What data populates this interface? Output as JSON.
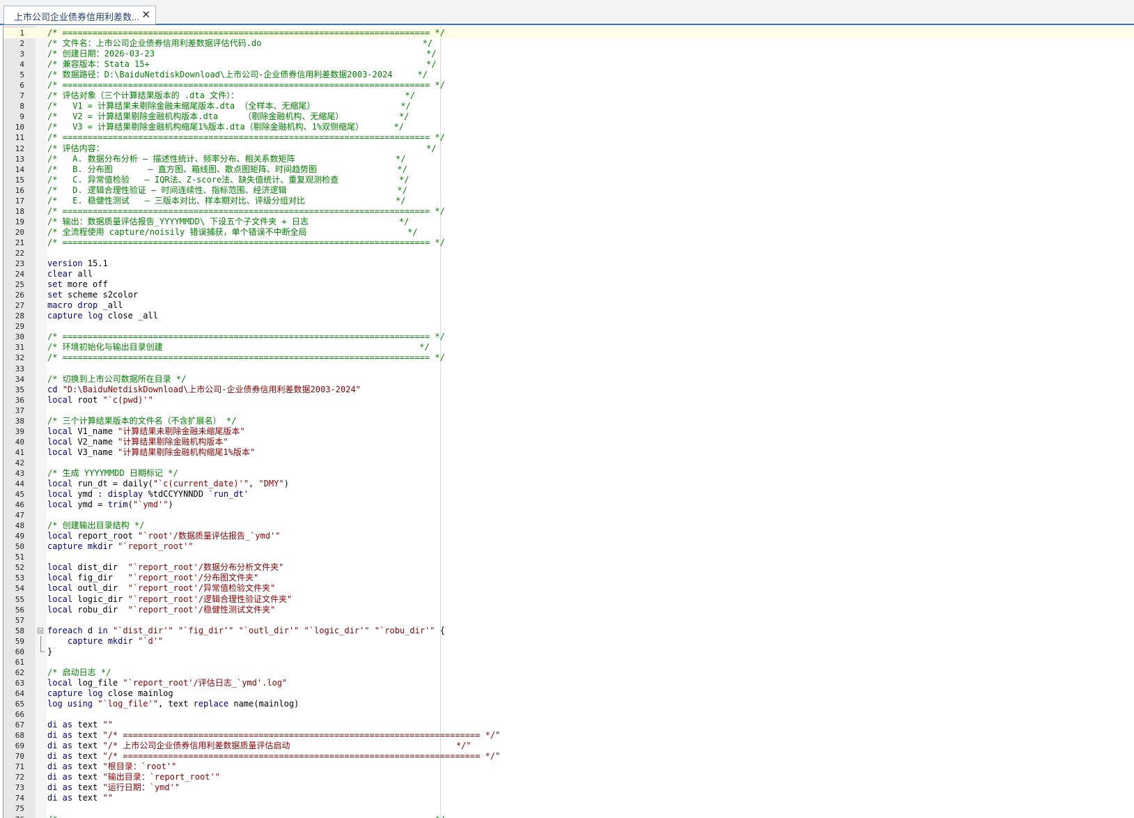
{
  "tab": {
    "title": "上市公司企业债券信用利差数...",
    "close": "✕"
  },
  "colors": {
    "comment": "#008000",
    "keyword": "#00008b",
    "string": "#8b0000",
    "plain": "#000000",
    "accent": "#3c73b4"
  },
  "current_line": 1,
  "fold": {
    "start": 58,
    "end": 60
  },
  "lines": [
    {
      "n": "1",
      "t": [
        {
          "c": "comment",
          "s": "/* ========================================================================= */"
        }
      ]
    },
    {
      "n": "2",
      "t": [
        {
          "c": "comment",
          "s": "/* 文件名：上市公司企业债券信用利差数据评估代码.do                                */"
        }
      ]
    },
    {
      "n": "3",
      "t": [
        {
          "c": "comment",
          "s": "/* 创建日期：2026-03-23                                                      */"
        }
      ]
    },
    {
      "n": "4",
      "t": [
        {
          "c": "comment",
          "s": "/* 兼容版本：Stata 15+                                                       */"
        }
      ]
    },
    {
      "n": "5",
      "t": [
        {
          "c": "comment",
          "s": "/* 数据路径：D:\\BaiduNetdiskDownload\\上市公司-企业债券信用利差数据2003-2024     */"
        }
      ]
    },
    {
      "n": "6",
      "t": [
        {
          "c": "comment",
          "s": "/* ========================================================================= */"
        }
      ]
    },
    {
      "n": "7",
      "t": [
        {
          "c": "comment",
          "s": "/* 评估对象（三个计算结果版本的 .dta 文件）：                                 */"
        }
      ]
    },
    {
      "n": "8",
      "t": [
        {
          "c": "comment",
          "s": "/*   V1 = 计算结果未剔除金融未缩尾版本.dta （全样本、无缩尾）                 */"
        }
      ]
    },
    {
      "n": "9",
      "t": [
        {
          "c": "comment",
          "s": "/*   V2 = 计算结果剔除金融机构版本.dta     （剔除金融机构、无缩尾）           */"
        }
      ]
    },
    {
      "n": "10",
      "t": [
        {
          "c": "comment",
          "s": "/*   V3 = 计算结果剔除金融机构缩尾1%版本.dta（剔除金融机构、1%双侧缩尾）      */"
        }
      ]
    },
    {
      "n": "11",
      "t": [
        {
          "c": "comment",
          "s": "/* ========================================================================= */"
        }
      ]
    },
    {
      "n": "12",
      "t": [
        {
          "c": "comment",
          "s": "/* 评估内容：                                                                */"
        }
      ]
    },
    {
      "n": "13",
      "t": [
        {
          "c": "comment",
          "s": "/*   A. 数据分布分析 — 描述性统计、频率分布、相关系数矩阵                    */"
        }
      ]
    },
    {
      "n": "14",
      "t": [
        {
          "c": "comment",
          "s": "/*   B. 分布图       — 直方图、箱线图、散点图矩阵、时间趋势图                */"
        }
      ]
    },
    {
      "n": "15",
      "t": [
        {
          "c": "comment",
          "s": "/*   C. 异常值检验   — IQR法、Z-score法、缺失值统计、重复观测检查            */"
        }
      ]
    },
    {
      "n": "16",
      "t": [
        {
          "c": "comment",
          "s": "/*   D. 逻辑合理性验证 — 时间连续性、指标范围、经济逻辑                      */"
        }
      ]
    },
    {
      "n": "17",
      "t": [
        {
          "c": "comment",
          "s": "/*   E. 稳健性测试   — 三版本对比、样本期对比、评级分组对比                  */"
        }
      ]
    },
    {
      "n": "18",
      "t": [
        {
          "c": "comment",
          "s": "/* ========================================================================= */"
        }
      ]
    },
    {
      "n": "19",
      "t": [
        {
          "c": "comment",
          "s": "/* 输出：数据质量评估报告_YYYYMMDD\\ 下设五个子文件夹 + 日志                  */"
        }
      ]
    },
    {
      "n": "20",
      "t": [
        {
          "c": "comment",
          "s": "/* 全流程使用 capture/noisily 错误捕获，单个错误不中断全局                    */"
        }
      ]
    },
    {
      "n": "21",
      "t": [
        {
          "c": "comment",
          "s": "/* ========================================================================= */"
        }
      ]
    },
    {
      "n": "22",
      "t": []
    },
    {
      "n": "23",
      "t": [
        {
          "c": "keyword",
          "s": "version"
        },
        {
          "c": "plain",
          "s": " 15.1"
        }
      ]
    },
    {
      "n": "24",
      "t": [
        {
          "c": "keyword",
          "s": "clear"
        },
        {
          "c": "plain",
          "s": " all"
        }
      ]
    },
    {
      "n": "25",
      "t": [
        {
          "c": "keyword",
          "s": "set"
        },
        {
          "c": "plain",
          "s": " more off"
        }
      ]
    },
    {
      "n": "26",
      "t": [
        {
          "c": "keyword",
          "s": "set"
        },
        {
          "c": "plain",
          "s": " scheme s2color"
        }
      ]
    },
    {
      "n": "27",
      "t": [
        {
          "c": "keyword",
          "s": "macro drop"
        },
        {
          "c": "plain",
          "s": " _all"
        }
      ]
    },
    {
      "n": "28",
      "t": [
        {
          "c": "keyword",
          "s": "capture log"
        },
        {
          "c": "plain",
          "s": " close _all"
        }
      ]
    },
    {
      "n": "29",
      "t": []
    },
    {
      "n": "30",
      "t": [
        {
          "c": "comment",
          "s": "/* ========================================================================= */"
        }
      ]
    },
    {
      "n": "31",
      "t": [
        {
          "c": "comment",
          "s": "/* 环境初始化与输出目录创建                                                   */"
        }
      ]
    },
    {
      "n": "32",
      "t": [
        {
          "c": "comment",
          "s": "/* ========================================================================= */"
        }
      ]
    },
    {
      "n": "33",
      "t": []
    },
    {
      "n": "34",
      "t": [
        {
          "c": "comment",
          "s": "/* 切换到上市公司数据所在目录 */"
        }
      ]
    },
    {
      "n": "35",
      "t": [
        {
          "c": "keyword",
          "s": "cd"
        },
        {
          "c": "plain",
          "s": " "
        },
        {
          "c": "string",
          "s": "\"D:\\BaiduNetdiskDownload\\上市公司-企业债券信用利差数据2003-2024\""
        }
      ]
    },
    {
      "n": "36",
      "t": [
        {
          "c": "keyword",
          "s": "local"
        },
        {
          "c": "plain",
          "s": " root "
        },
        {
          "c": "string",
          "s": "\"`c(pwd)'\""
        }
      ]
    },
    {
      "n": "37",
      "t": []
    },
    {
      "n": "38",
      "t": [
        {
          "c": "comment",
          "s": "/* 三个计算结果版本的文件名（不含扩展名） */"
        }
      ]
    },
    {
      "n": "39",
      "t": [
        {
          "c": "keyword",
          "s": "local"
        },
        {
          "c": "plain",
          "s": " V1_name "
        },
        {
          "c": "string",
          "s": "\"计算结果未剔除金融未缩尾版本\""
        }
      ]
    },
    {
      "n": "40",
      "t": [
        {
          "c": "keyword",
          "s": "local"
        },
        {
          "c": "plain",
          "s": " V2_name "
        },
        {
          "c": "string",
          "s": "\"计算结果剔除金融机构版本\""
        }
      ]
    },
    {
      "n": "41",
      "t": [
        {
          "c": "keyword",
          "s": "local"
        },
        {
          "c": "plain",
          "s": " V3_name "
        },
        {
          "c": "string",
          "s": "\"计算结果剔除金融机构缩尾1%版本\""
        }
      ]
    },
    {
      "n": "42",
      "t": []
    },
    {
      "n": "43",
      "t": [
        {
          "c": "comment",
          "s": "/* 生成 YYYYMMDD 日期标记 */"
        }
      ]
    },
    {
      "n": "44",
      "t": [
        {
          "c": "keyword",
          "s": "local"
        },
        {
          "c": "plain",
          "s": " run_dt = daily("
        },
        {
          "c": "string",
          "s": "\"`c(current_date)'\""
        },
        {
          "c": "plain",
          "s": ", "
        },
        {
          "c": "string",
          "s": "\"DMY\""
        },
        {
          "c": "plain",
          "s": ")"
        }
      ]
    },
    {
      "n": "45",
      "t": [
        {
          "c": "keyword",
          "s": "local"
        },
        {
          "c": "plain",
          "s": " ymd : "
        },
        {
          "c": "keyword",
          "s": "display"
        },
        {
          "c": "plain",
          "s": " %tdCCYYNNDD "
        },
        {
          "c": "macro",
          "s": "`run_dt'"
        }
      ]
    },
    {
      "n": "46",
      "t": [
        {
          "c": "keyword",
          "s": "local"
        },
        {
          "c": "plain",
          "s": " ymd = "
        },
        {
          "c": "keyword",
          "s": "trim"
        },
        {
          "c": "plain",
          "s": "("
        },
        {
          "c": "string",
          "s": "\"`ymd'\""
        },
        {
          "c": "plain",
          "s": ")"
        }
      ]
    },
    {
      "n": "47",
      "t": []
    },
    {
      "n": "48",
      "t": [
        {
          "c": "comment",
          "s": "/* 创建输出目录结构 */"
        }
      ]
    },
    {
      "n": "49",
      "t": [
        {
          "c": "keyword",
          "s": "local"
        },
        {
          "c": "plain",
          "s": " report_root "
        },
        {
          "c": "string",
          "s": "\"`root'/数据质量评估报告_`ymd'\""
        }
      ]
    },
    {
      "n": "50",
      "t": [
        {
          "c": "keyword",
          "s": "capture mkdir"
        },
        {
          "c": "plain",
          "s": " "
        },
        {
          "c": "string",
          "s": "\"`report_root'\""
        }
      ]
    },
    {
      "n": "51",
      "t": []
    },
    {
      "n": "52",
      "t": [
        {
          "c": "keyword",
          "s": "local"
        },
        {
          "c": "plain",
          "s": " dist_dir  "
        },
        {
          "c": "string",
          "s": "\"`report_root'/数据分布分析文件夹\""
        }
      ]
    },
    {
      "n": "53",
      "t": [
        {
          "c": "keyword",
          "s": "local"
        },
        {
          "c": "plain",
          "s": " fig_dir   "
        },
        {
          "c": "string",
          "s": "\"`report_root'/分布图文件夹\""
        }
      ]
    },
    {
      "n": "54",
      "t": [
        {
          "c": "keyword",
          "s": "local"
        },
        {
          "c": "plain",
          "s": " outl_dir  "
        },
        {
          "c": "string",
          "s": "\"`report_root'/异常值检验文件夹\""
        }
      ]
    },
    {
      "n": "55",
      "t": [
        {
          "c": "keyword",
          "s": "local"
        },
        {
          "c": "plain",
          "s": " logic_dir "
        },
        {
          "c": "string",
          "s": "\"`report_root'/逻辑合理性验证文件夹\""
        }
      ]
    },
    {
      "n": "56",
      "t": [
        {
          "c": "keyword",
          "s": "local"
        },
        {
          "c": "plain",
          "s": " robu_dir  "
        },
        {
          "c": "string",
          "s": "\"`report_root'/稳健性测试文件夹\""
        }
      ]
    },
    {
      "n": "57",
      "t": []
    },
    {
      "n": "58",
      "t": [
        {
          "c": "keyword",
          "s": "foreach"
        },
        {
          "c": "plain",
          "s": " d "
        },
        {
          "c": "keyword",
          "s": "in"
        },
        {
          "c": "plain",
          "s": " "
        },
        {
          "c": "string",
          "s": "\"`dist_dir'\""
        },
        {
          "c": "plain",
          "s": " "
        },
        {
          "c": "string",
          "s": "\"`fig_dir'\""
        },
        {
          "c": "plain",
          "s": " "
        },
        {
          "c": "string",
          "s": "\"`outl_dir'\""
        },
        {
          "c": "plain",
          "s": " "
        },
        {
          "c": "string",
          "s": "\"`logic_dir'\""
        },
        {
          "c": "plain",
          "s": " "
        },
        {
          "c": "string",
          "s": "\"`robu_dir'\""
        },
        {
          "c": "plain",
          "s": " {"
        }
      ]
    },
    {
      "n": "59",
      "t": [
        {
          "c": "plain",
          "s": "    "
        },
        {
          "c": "keyword",
          "s": "capture mkdir"
        },
        {
          "c": "plain",
          "s": " "
        },
        {
          "c": "string",
          "s": "\"`d'\""
        }
      ]
    },
    {
      "n": "60",
      "t": [
        {
          "c": "plain",
          "s": "}"
        }
      ]
    },
    {
      "n": "61",
      "t": []
    },
    {
      "n": "62",
      "t": [
        {
          "c": "comment",
          "s": "/* 启动日志 */"
        }
      ]
    },
    {
      "n": "63",
      "t": [
        {
          "c": "keyword",
          "s": "local"
        },
        {
          "c": "plain",
          "s": " log_file "
        },
        {
          "c": "string",
          "s": "\"`report_root'/评估日志_`ymd'.log\""
        }
      ]
    },
    {
      "n": "64",
      "t": [
        {
          "c": "keyword",
          "s": "capture log"
        },
        {
          "c": "plain",
          "s": " close mainlog"
        }
      ]
    },
    {
      "n": "65",
      "t": [
        {
          "c": "keyword",
          "s": "log using"
        },
        {
          "c": "plain",
          "s": " "
        },
        {
          "c": "string",
          "s": "\"`log_file'\""
        },
        {
          "c": "plain",
          "s": ", text "
        },
        {
          "c": "keyword",
          "s": "replace"
        },
        {
          "c": "plain",
          "s": " name(mainlog)"
        }
      ]
    },
    {
      "n": "66",
      "t": []
    },
    {
      "n": "67",
      "t": [
        {
          "c": "keyword",
          "s": "di as"
        },
        {
          "c": "plain",
          "s": " text "
        },
        {
          "c": "string",
          "s": "\"\""
        }
      ]
    },
    {
      "n": "68",
      "t": [
        {
          "c": "keyword",
          "s": "di as"
        },
        {
          "c": "plain",
          "s": " text "
        },
        {
          "c": "string",
          "s": "\"/* ======================================================================= */\""
        }
      ]
    },
    {
      "n": "69",
      "t": [
        {
          "c": "keyword",
          "s": "di as"
        },
        {
          "c": "plain",
          "s": " text "
        },
        {
          "c": "string",
          "s": "\"/* 上市公司企业债券信用利差数据质量评估启动                                 */\""
        }
      ]
    },
    {
      "n": "70",
      "t": [
        {
          "c": "keyword",
          "s": "di as"
        },
        {
          "c": "plain",
          "s": " text "
        },
        {
          "c": "string",
          "s": "\"/* ======================================================================= */\""
        }
      ]
    },
    {
      "n": "71",
      "t": [
        {
          "c": "keyword",
          "s": "di as"
        },
        {
          "c": "plain",
          "s": " text "
        },
        {
          "c": "string",
          "s": "\"根目录：`root'\""
        }
      ]
    },
    {
      "n": "72",
      "t": [
        {
          "c": "keyword",
          "s": "di as"
        },
        {
          "c": "plain",
          "s": " text "
        },
        {
          "c": "string",
          "s": "\"输出目录：`report_root'\""
        }
      ]
    },
    {
      "n": "73",
      "t": [
        {
          "c": "keyword",
          "s": "di as"
        },
        {
          "c": "plain",
          "s": " text "
        },
        {
          "c": "string",
          "s": "\"运行日期：`ymd'\""
        }
      ]
    },
    {
      "n": "74",
      "t": [
        {
          "c": "keyword",
          "s": "di as"
        },
        {
          "c": "plain",
          "s": " text "
        },
        {
          "c": "string",
          "s": "\"\""
        }
      ]
    },
    {
      "n": "75",
      "t": []
    },
    {
      "n": "76",
      "t": [
        {
          "c": "comment",
          "s": "/* ========================================================================= */"
        }
      ]
    }
  ]
}
